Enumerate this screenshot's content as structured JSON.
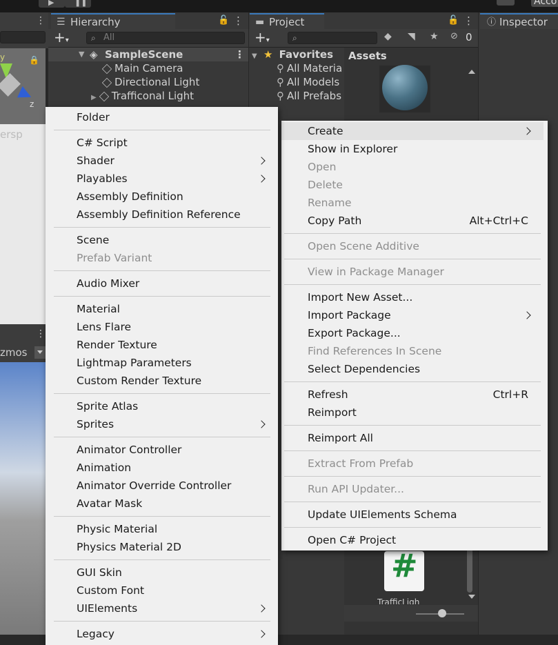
{
  "colors": {
    "accent": "#3a79bb",
    "menu_bg": "#f0f0f0",
    "editor_bg": "#383838"
  },
  "toolbar": {
    "account_label": "Acco"
  },
  "hierarchy": {
    "tab_label": "Hierarchy",
    "search_placeholder": "All",
    "scene_name": "SampleScene",
    "items": [
      "Main Camera",
      "Directional Light",
      "Trafficonal Light"
    ]
  },
  "project": {
    "tab_label": "Project",
    "favorites_label": "Favorites",
    "favorites": [
      "All Materia",
      "All Models",
      "All Prefabs"
    ],
    "assets_label": "Assets",
    "hidden_count": "0",
    "bottom_asset_label": "TrafficLigh"
  },
  "inspector": {
    "tab_label": "Inspector"
  },
  "scene_view": {
    "persp_label": "ersp",
    "gizmos_label": "zmos",
    "axis_z": "z",
    "axis_y": "y"
  },
  "context_menu": {
    "items": [
      {
        "label": "Create",
        "has_submenu": true
      },
      {
        "label": "Show in Explorer"
      },
      {
        "label": "Open",
        "disabled": true
      },
      {
        "label": "Delete",
        "disabled": true
      },
      {
        "label": "Rename",
        "disabled": true
      },
      {
        "label": "Copy Path",
        "shortcut": "Alt+Ctrl+C"
      },
      {
        "label": "Open Scene Additive",
        "disabled": true
      },
      {
        "label": "View in Package Manager",
        "disabled": true
      },
      {
        "label": "Import New Asset..."
      },
      {
        "label": "Import Package",
        "has_submenu": true
      },
      {
        "label": "Export Package..."
      },
      {
        "label": "Find References In Scene",
        "disabled": true
      },
      {
        "label": "Select Dependencies"
      },
      {
        "label": "Refresh",
        "shortcut": "Ctrl+R"
      },
      {
        "label": "Reimport"
      },
      {
        "label": "Reimport All"
      },
      {
        "label": "Extract From Prefab",
        "disabled": true
      },
      {
        "label": "Run API Updater...",
        "disabled": true
      },
      {
        "label": "Update UIElements Schema"
      },
      {
        "label": "Open C# Project"
      }
    ]
  },
  "create_menu": {
    "items": [
      {
        "label": "Folder"
      },
      {
        "label": "C# Script"
      },
      {
        "label": "Shader",
        "has_submenu": true
      },
      {
        "label": "Playables",
        "has_submenu": true
      },
      {
        "label": "Assembly Definition"
      },
      {
        "label": "Assembly Definition Reference"
      },
      {
        "label": "Scene"
      },
      {
        "label": "Prefab Variant",
        "disabled": true
      },
      {
        "label": "Audio Mixer"
      },
      {
        "label": "Material"
      },
      {
        "label": "Lens Flare"
      },
      {
        "label": "Render Texture"
      },
      {
        "label": "Lightmap Parameters"
      },
      {
        "label": "Custom Render Texture"
      },
      {
        "label": "Sprite Atlas"
      },
      {
        "label": "Sprites",
        "has_submenu": true
      },
      {
        "label": "Animator Controller"
      },
      {
        "label": "Animation"
      },
      {
        "label": "Animator Override Controller"
      },
      {
        "label": "Avatar Mask"
      },
      {
        "label": "Physic Material"
      },
      {
        "label": "Physics Material 2D"
      },
      {
        "label": "GUI Skin"
      },
      {
        "label": "Custom Font"
      },
      {
        "label": "UIElements",
        "has_submenu": true
      },
      {
        "label": "Legacy",
        "has_submenu": true
      }
    ]
  }
}
